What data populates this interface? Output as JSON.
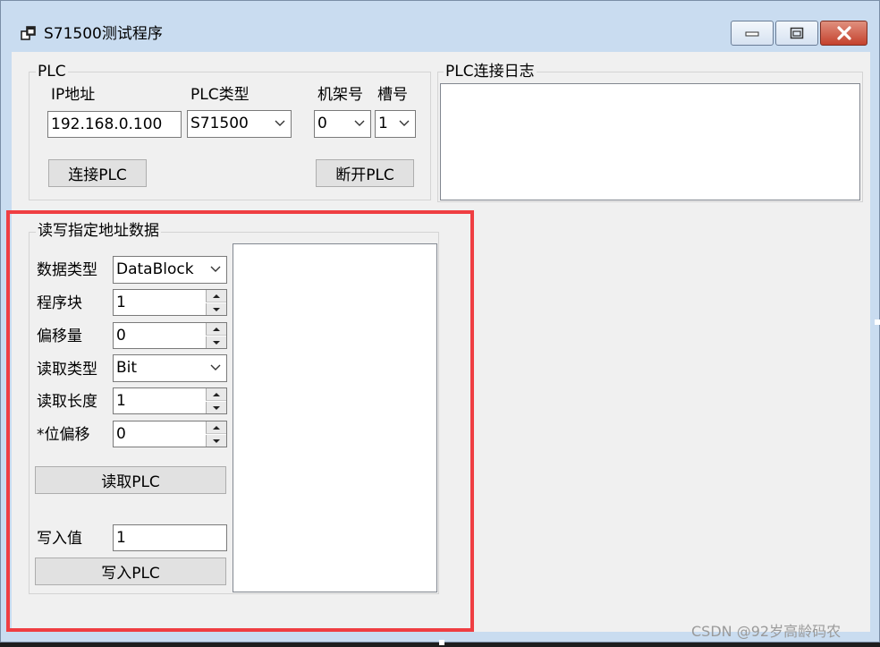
{
  "window": {
    "title": "S71500测试程序",
    "icon": "app-window-icon",
    "controls": {
      "minimize": "minimize-icon",
      "maximize": "maximize-icon",
      "close": "close-icon"
    }
  },
  "connection": {
    "group_label": "PLC",
    "ip_label": "IP地址",
    "ip_value": "192.168.0.100",
    "type_label": "PLC类型",
    "type_value": "S71500",
    "rack_label": "机架号",
    "rack_value": "0",
    "slot_label": "槽号",
    "slot_value": "1",
    "connect_button": "连接PLC",
    "disconnect_button": "断开PLC"
  },
  "log": {
    "group_label": "PLC连接日志"
  },
  "readwrite": {
    "group_label": "读写指定地址数据",
    "data_type_label": "数据类型",
    "data_type_value": "DataBlock",
    "block_label": "程序块",
    "block_value": "1",
    "offset_label": "偏移量",
    "offset_value": "0",
    "read_type_label": "读取类型",
    "read_type_value": "Bit",
    "read_length_label": "读取长度",
    "read_length_value": "1",
    "bit_offset_label": "*位偏移",
    "bit_offset_value": "0",
    "read_button": "读取PLC",
    "write_value_label": "写入值",
    "write_value": "1",
    "write_button": "写入PLC"
  },
  "watermark": "CSDN @92岁高龄码农",
  "colors": {
    "highlight": "#ef3e42",
    "titlebar": "#c9dcf0",
    "client": "#f0f0f0",
    "close": "#c4412d"
  }
}
